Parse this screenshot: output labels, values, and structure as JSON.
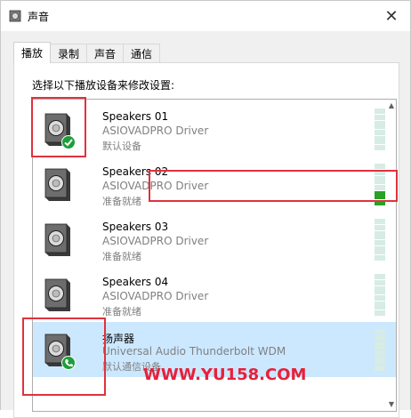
{
  "window": {
    "title": "声音",
    "close_glyph": "✕"
  },
  "tabs": [
    {
      "label": "播放",
      "active": true
    },
    {
      "label": "录制",
      "active": false
    },
    {
      "label": "声音",
      "active": false
    },
    {
      "label": "通信",
      "active": false
    }
  ],
  "instruction": "选择以下播放设备来修改设置:",
  "devices": [
    {
      "name": "Speakers 01",
      "driver": "ASIOVADPRO Driver",
      "status": "默认设备",
      "badge": "check-icon",
      "level": 0
    },
    {
      "name": "Speakers 02",
      "driver": "ASIOVADPRO Driver",
      "status": "准备就绪",
      "badge": "",
      "level": 0.35
    },
    {
      "name": "Speakers 03",
      "driver": "ASIOVADPRO Driver",
      "status": "准备就绪",
      "badge": "",
      "level": 0
    },
    {
      "name": "Speakers 04",
      "driver": "ASIOVADPRO Driver",
      "status": "准备就绪",
      "badge": "",
      "level": 0
    },
    {
      "name": "扬声器",
      "driver": "Universal Audio Thunderbolt WDM",
      "status": "默认通信设备",
      "badge": "phone-icon",
      "level": 0,
      "selected": true
    }
  ],
  "watermark": "WWW.YU158.COM",
  "colors": {
    "accent_selected": "#cce8ff",
    "meter_on": "#27a127",
    "meter_off": "#d6ece4",
    "annotation": "#e0323d",
    "badge_green": "#1e9e3a"
  }
}
